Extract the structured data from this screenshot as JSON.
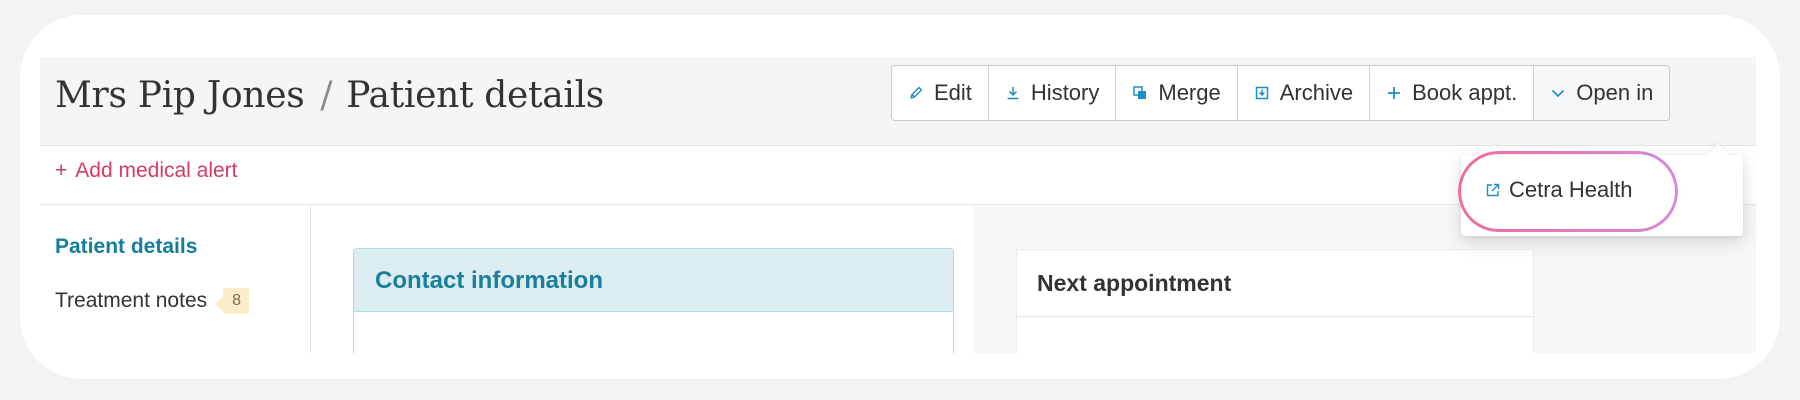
{
  "breadcrumb": {
    "patient": "Mrs Pip Jones",
    "separator": "/",
    "page": "Patient details"
  },
  "toolbar": {
    "edit": "Edit",
    "history": "History",
    "merge": "Merge",
    "archive": "Archive",
    "book": "Book appt.",
    "open_in": "Open in"
  },
  "alert": {
    "plus": "+",
    "label": "Add medical alert"
  },
  "sidebar": {
    "items": [
      {
        "label": "Patient details"
      },
      {
        "label": "Treatment notes",
        "badge": "8"
      }
    ]
  },
  "main": {
    "contact_title": "Contact information"
  },
  "right": {
    "appt_title": "Next appointment"
  },
  "dropdown": {
    "item": "Cetra Health"
  },
  "colors": {
    "accent": "#1b8fc1",
    "alert": "#d53a66",
    "active_nav": "#137e9c",
    "badge_bg": "#fbedc8",
    "highlight_start": "#f16aa0",
    "highlight_end": "#d48ad9"
  },
  "icons": {
    "edit": "pencil-icon",
    "history": "download-icon",
    "merge": "merge-icon",
    "archive": "archive-icon",
    "book": "plus-icon",
    "open_in": "chevron-down-icon",
    "dropdown_item": "external-link-icon"
  }
}
